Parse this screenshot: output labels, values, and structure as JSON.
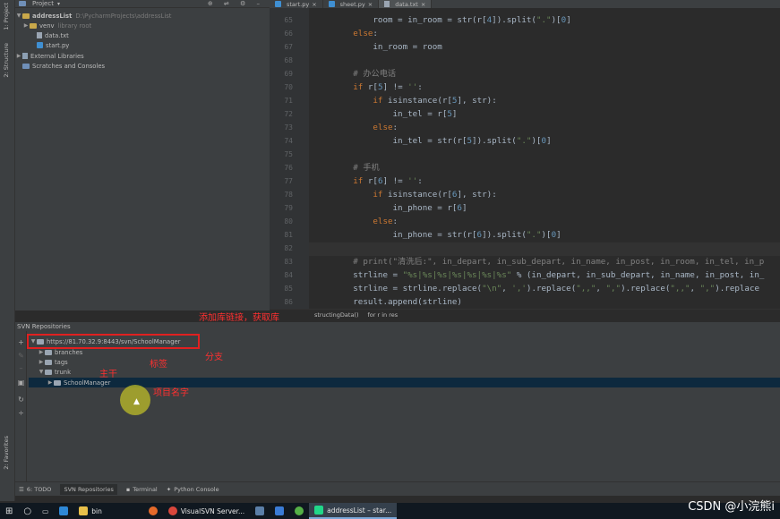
{
  "side_strip": {
    "project": "1: Project",
    "structure": "2: Structure",
    "favorites": "2: Favorites"
  },
  "project_panel": {
    "title": "Project",
    "items": [
      {
        "label": "addressList",
        "path": "D:\\PycharmProjects\\addressList"
      },
      {
        "label": "venv",
        "note": "library root"
      },
      {
        "label": "data.txt"
      },
      {
        "label": "start.py"
      },
      {
        "label": "External Libraries"
      },
      {
        "label": "Scratches and Consoles"
      }
    ]
  },
  "editor": {
    "tabs": [
      {
        "label": "start.py"
      },
      {
        "label": "sheet.py"
      },
      {
        "label": "data.txt"
      }
    ],
    "lines": [
      {
        "n": "65",
        "html": "            room = in_room = str(r[<span class=nu>4</span>]).split(<span class=st>\".\"</span>)[<span class=nu>0</span>]"
      },
      {
        "n": "66",
        "html": "        <span class=kw>else</span>:"
      },
      {
        "n": "67",
        "html": "            in_room = room"
      },
      {
        "n": "68",
        "html": ""
      },
      {
        "n": "69",
        "html": "        <span class=cm># 办公电话</span>"
      },
      {
        "n": "70",
        "html": "        <span class=kw>if</span> r[<span class=nu>5</span>] != <span class=st>''</span>:"
      },
      {
        "n": "71",
        "html": "            <span class=kw>if</span> isinstance(r[<span class=nu>5</span>], str):"
      },
      {
        "n": "72",
        "html": "                in_tel = r[<span class=nu>5</span>]"
      },
      {
        "n": "73",
        "html": "            <span class=kw>else</span>:"
      },
      {
        "n": "74",
        "html": "                in_tel = str(r[<span class=nu>5</span>]).split(<span class=st>\".\"</span>)[<span class=nu>0</span>]"
      },
      {
        "n": "75",
        "html": ""
      },
      {
        "n": "76",
        "html": "        <span class=cm># 手机</span>"
      },
      {
        "n": "77",
        "html": "        <span class=kw>if</span> r[<span class=nu>6</span>] != <span class=st>''</span>:"
      },
      {
        "n": "78",
        "html": "            <span class=kw>if</span> isinstance(r[<span class=nu>6</span>], str):"
      },
      {
        "n": "79",
        "html": "                in_phone = r[<span class=nu>6</span>]"
      },
      {
        "n": "80",
        "html": "            <span class=kw>else</span>:"
      },
      {
        "n": "81",
        "html": "                in_phone = str(r[<span class=nu>6</span>]).split(<span class=st>\".\"</span>)[<span class=nu>0</span>]"
      },
      {
        "n": "82",
        "html": ""
      },
      {
        "n": "83",
        "html": "        <span class=cm># print(\"清洗后:\", in_depart, in_sub_depart, in_name, in_post, in_room, in_tel, in_p</span>"
      },
      {
        "n": "84",
        "html": "        strline = <span class=st>\"%s|%s|%s|%s|%s|%s|%s\"</span> % (in_depart, in_sub_depart, in_name, in_post, in_"
      },
      {
        "n": "85",
        "html": "        strline = strline.replace(<span class=st>\"\\n\"</span>, <span class=st>','</span>).replace(<span class=st>\",,\"</span>, <span class=st>\",\"</span>).replace(<span class=st>\",,\"</span>, <span class=st>\",\"</span>).replace"
      },
      {
        "n": "86",
        "html": "        result.append(strline)"
      }
    ],
    "breadcrumb": [
      "structingData()",
      "for r in res"
    ]
  },
  "svn": {
    "header": "SVN Repositories",
    "tree": [
      {
        "label": "https://81.70.32.9:8443/svn/SchoolManager"
      },
      {
        "label": "branches"
      },
      {
        "label": "tags"
      },
      {
        "label": "trunk"
      },
      {
        "label": "SchoolManager"
      }
    ]
  },
  "annotations": {
    "add_repo": "添加库链接，获取库",
    "branch": "分支",
    "tag": "标签",
    "trunk": "主干",
    "project_name": "项目名字"
  },
  "bottom_tabs": [
    {
      "label": "6: TODO",
      "icon": "list-icon"
    },
    {
      "label": "SVN Repositories",
      "icon": "svn-icon"
    },
    {
      "label": "Terminal",
      "icon": "terminal-icon"
    },
    {
      "label": "Python Console",
      "icon": "python-icon"
    }
  ],
  "taskbar": {
    "items": [
      {
        "label": "bin"
      },
      {
        "label": "VisualSVN Server..."
      },
      {
        "label": "addressList – star..."
      }
    ]
  },
  "watermark": "CSDN @小浣熊i",
  "colors": {
    "annotation": "#e02020",
    "selection": "#0d293e"
  }
}
